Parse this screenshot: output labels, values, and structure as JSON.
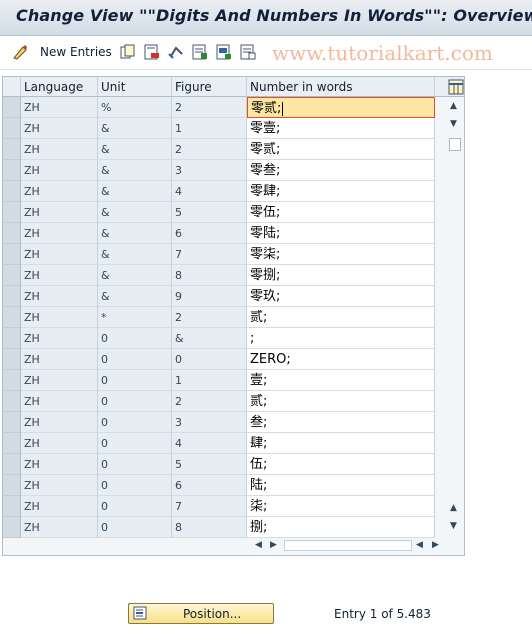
{
  "title": "Change View \"\"Digits And Numbers In Words\"\": Overview",
  "toolbar": {
    "new_entries_label": "New Entries",
    "watermark": "www.tutorialkart.com"
  },
  "table": {
    "headers": [
      "Language",
      "Unit",
      "Figure",
      "Number in words"
    ],
    "rows": [
      [
        "ZH",
        "%",
        "2",
        "零贰;"
      ],
      [
        "ZH",
        "&",
        "1",
        "零壹;"
      ],
      [
        "ZH",
        "&",
        "2",
        "零贰;"
      ],
      [
        "ZH",
        "&",
        "3",
        "零叁;"
      ],
      [
        "ZH",
        "&",
        "4",
        "零肆;"
      ],
      [
        "ZH",
        "&",
        "5",
        "零伍;"
      ],
      [
        "ZH",
        "&",
        "6",
        "零陆;"
      ],
      [
        "ZH",
        "&",
        "7",
        "零柒;"
      ],
      [
        "ZH",
        "&",
        "8",
        "零捌;"
      ],
      [
        "ZH",
        "&",
        "9",
        "零玖;"
      ],
      [
        "ZH",
        "*",
        "2",
        "贰;"
      ],
      [
        "ZH",
        "0",
        "&",
        ";"
      ],
      [
        "ZH",
        "0",
        "0",
        "ZERO;"
      ],
      [
        "ZH",
        "0",
        "1",
        "壹;"
      ],
      [
        "ZH",
        "0",
        "2",
        "贰;"
      ],
      [
        "ZH",
        "0",
        "3",
        "叁;"
      ],
      [
        "ZH",
        "0",
        "4",
        "肆;"
      ],
      [
        "ZH",
        "0",
        "5",
        "伍;"
      ],
      [
        "ZH",
        "0",
        "6",
        "陆;"
      ],
      [
        "ZH",
        "0",
        "7",
        "柒;"
      ],
      [
        "ZH",
        "0",
        "8",
        "捌;"
      ]
    ]
  },
  "footer": {
    "position_label": "Position...",
    "entry_text": "Entry 1 of 5.483"
  },
  "colors": {
    "title_bar": "#d3dde6",
    "selected_cell": "#fde6a2",
    "selected_border": "#e05030",
    "position_button": "#f8df86"
  }
}
